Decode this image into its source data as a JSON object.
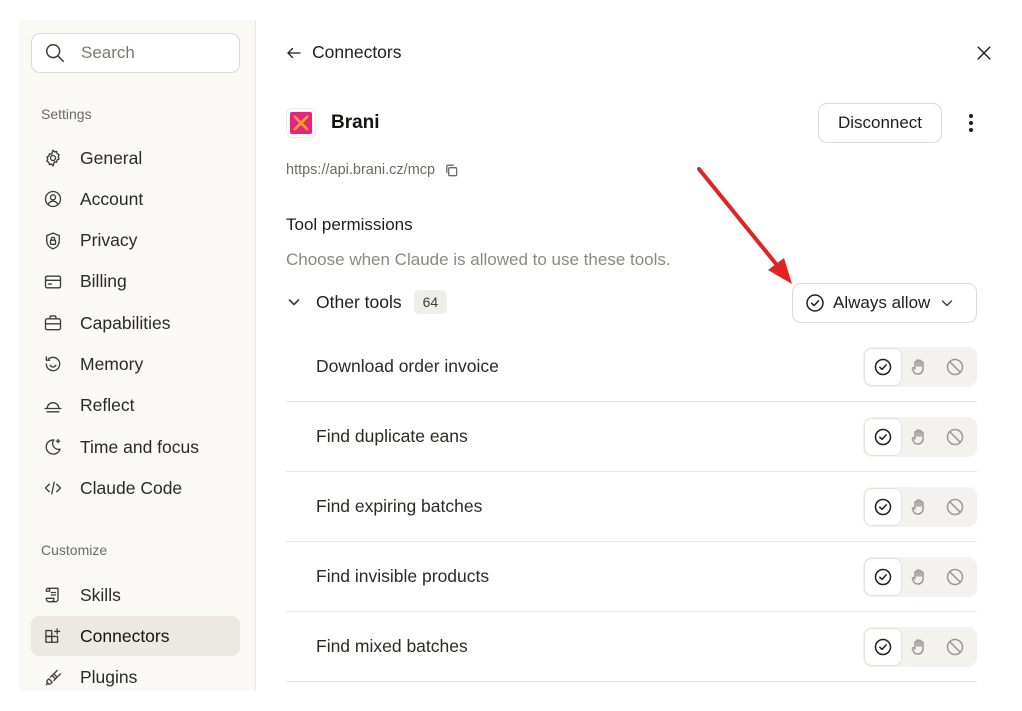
{
  "sidebar": {
    "search": {
      "placeholder": "Search"
    },
    "settings_label": "Settings",
    "settings_items": [
      {
        "label": "General",
        "icon": "gear-icon"
      },
      {
        "label": "Account",
        "icon": "user-circle-icon"
      },
      {
        "label": "Privacy",
        "icon": "shield-lock-icon"
      },
      {
        "label": "Billing",
        "icon": "credit-card-icon"
      },
      {
        "label": "Capabilities",
        "icon": "briefcase-icon"
      },
      {
        "label": "Memory",
        "icon": "history-icon"
      },
      {
        "label": "Reflect",
        "icon": "sunset-icon"
      },
      {
        "label": "Time and focus",
        "icon": "moon-sparkle-icon"
      },
      {
        "label": "Claude Code",
        "icon": "code-icon"
      }
    ],
    "customize_label": "Customize",
    "customize_items": [
      {
        "label": "Skills",
        "icon": "scroll-icon"
      },
      {
        "label": "Connectors",
        "icon": "grid-plus-icon",
        "active": true
      },
      {
        "label": "Plugins",
        "icon": "plug-icon"
      }
    ]
  },
  "header": {
    "back_label": "Connectors",
    "back_icon": "arrow-left-icon",
    "close_icon": "close-icon"
  },
  "connector": {
    "name": "Brani",
    "url": "https://api.brani.cz/mcp",
    "disconnect_label": "Disconnect",
    "logo_colors": {
      "bg": "#e8237e",
      "cross": "#f5a623"
    }
  },
  "permissions": {
    "title": "Tool permissions",
    "description": "Choose when Claude is allowed to use these tools.",
    "group": {
      "name": "Other tools",
      "count": "64",
      "policy": "Always allow"
    },
    "tools": [
      {
        "name": "Download order invoice",
        "selected": "allow"
      },
      {
        "name": "Find duplicate eans",
        "selected": "allow"
      },
      {
        "name": "Find expiring batches",
        "selected": "allow"
      },
      {
        "name": "Find invisible products",
        "selected": "allow"
      },
      {
        "name": "Find mixed batches",
        "selected": "allow"
      }
    ]
  },
  "annotation": {
    "arrow_color": "#e02424"
  }
}
